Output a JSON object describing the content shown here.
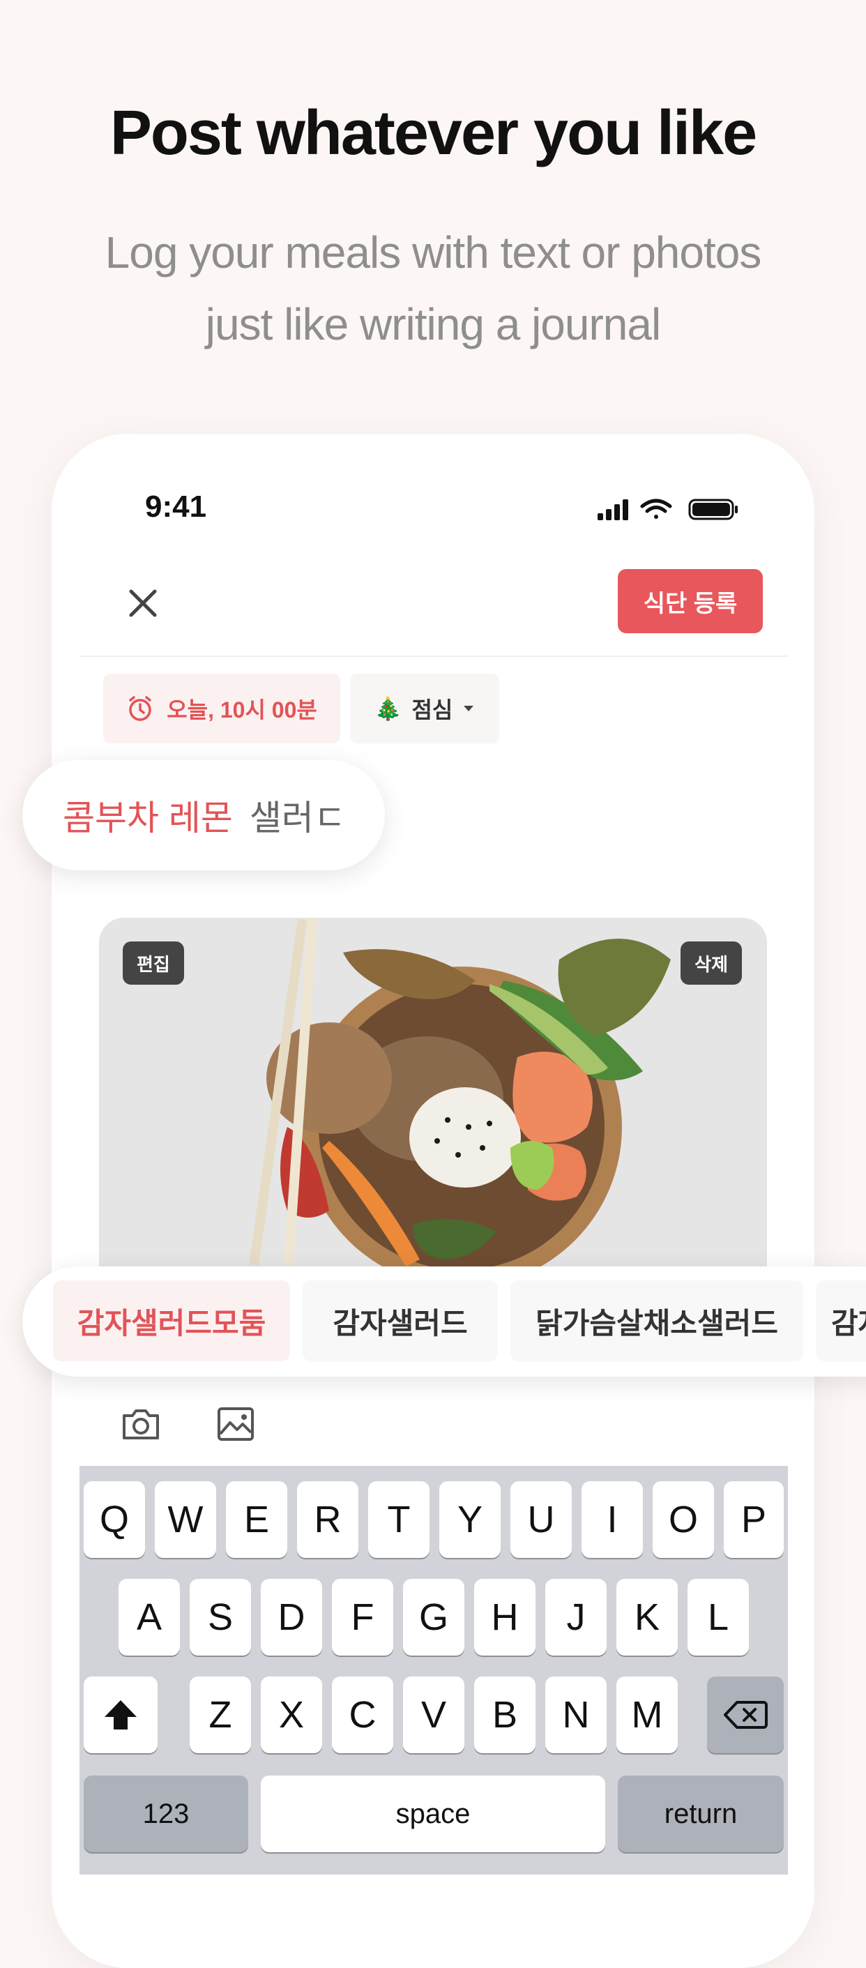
{
  "marketing": {
    "headline": "Post whatever you like",
    "subline_1": "Log your meals with text or photos",
    "subline_2": "just like writing a journal"
  },
  "status_bar": {
    "time": "9:41"
  },
  "header": {
    "submit_label": "식단 등록"
  },
  "meta": {
    "time_label": "오늘, 10시 00분",
    "meal_emoji": "🎄",
    "meal_label": "점심"
  },
  "title_input": {
    "typed": "콤부차 레몬",
    "composing": "샐러ㄷ"
  },
  "photo": {
    "edit_label": "편집",
    "delete_label": "삭제"
  },
  "suggestions": [
    {
      "label": "감자샐러드모둠",
      "active": true
    },
    {
      "label": "감자샐러드",
      "active": false
    },
    {
      "label": "닭가슴살채소샐러드",
      "active": false
    },
    {
      "label": "감자",
      "active": false
    }
  ],
  "toolbar": {
    "camera_icon": "camera-icon",
    "gallery_icon": "image-gallery-icon"
  },
  "keyboard": {
    "row1": [
      "Q",
      "W",
      "E",
      "R",
      "T",
      "Y",
      "U",
      "I",
      "O",
      "P"
    ],
    "row2": [
      "A",
      "S",
      "D",
      "F",
      "G",
      "H",
      "J",
      "K",
      "L"
    ],
    "row3": [
      "Z",
      "X",
      "C",
      "V",
      "B",
      "N",
      "M"
    ],
    "numbers_label": "123",
    "space_label": "space",
    "return_label": "return"
  },
  "colors": {
    "accent": "#e8575b",
    "background": "#fcf6f5"
  }
}
